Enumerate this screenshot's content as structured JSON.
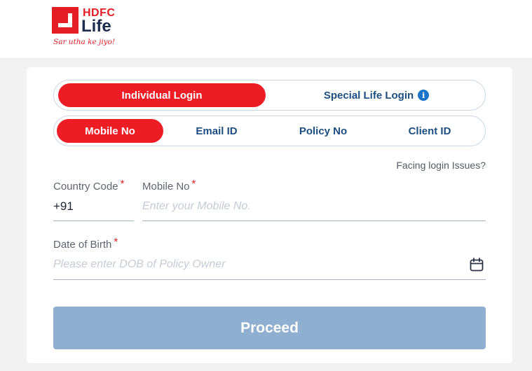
{
  "brand": {
    "name_top": "HDFC",
    "name_bottom": "Life",
    "tagline": "Sar utha ke jiyo!",
    "primary_color": "#ee1c25",
    "navy_color": "#1b2c4d"
  },
  "login_type": {
    "individual_label": "Individual Login",
    "special_label": "Special Life Login",
    "selected": "Individual Login"
  },
  "login_method": {
    "tabs": [
      "Mobile No",
      "Email ID",
      "Policy No",
      "Client ID"
    ],
    "selected": "Mobile No"
  },
  "help_link": "Facing login Issues?",
  "form": {
    "country_code_label": "Country Code",
    "country_code_value": "+91",
    "mobile_label": "Mobile No",
    "mobile_placeholder": "Enter your Mobile No.",
    "mobile_value": "",
    "dob_label": "Date of Birth",
    "dob_placeholder": "Please enter DOB of Policy Owner",
    "dob_value": "",
    "required_mark": "*"
  },
  "submit": {
    "label": "Proceed",
    "color": "#8eafcf"
  }
}
